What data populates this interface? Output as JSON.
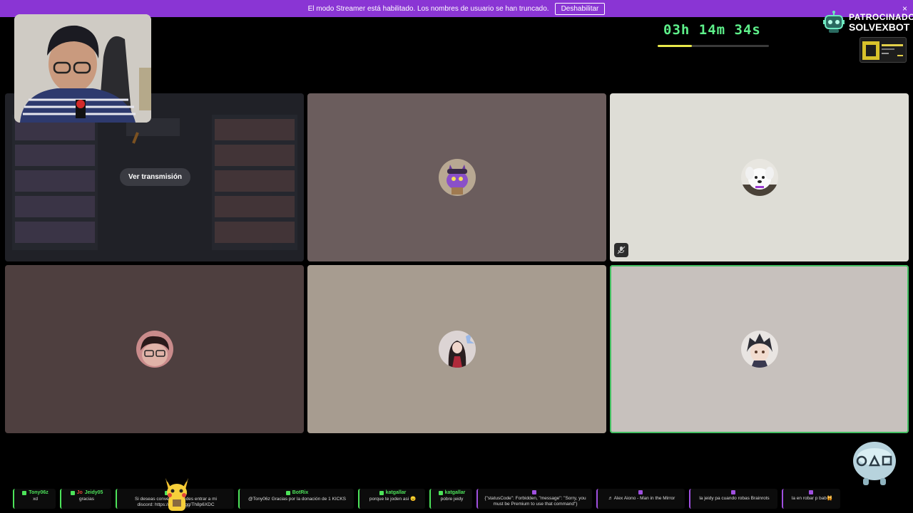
{
  "banner": {
    "message": "El modo Streamer está habilitado. Los nombres de usuario se han truncado.",
    "disable_label": "Deshabilitar",
    "close_glyph": "×"
  },
  "timer": {
    "value": "03h 14m 34s",
    "progress_fraction": 0.31
  },
  "sponsor": {
    "line1": "PATROCINADOR",
    "line2": "SOLVEXBOT",
    "icon": "robot-icon"
  },
  "stage": {
    "watch_label": "Ver transmisión",
    "tiles": [
      {
        "name": "screen-share-tile",
        "bg": "#25262c"
      },
      {
        "name": "participant-tile-2",
        "bg": "#6b5d5d",
        "avatar_bg": "#8a5cc0"
      },
      {
        "name": "participant-tile-3",
        "bg": "#deddd6",
        "avatar_bg": "#e4e4e4",
        "muted_icon": "mic-off-icon"
      },
      {
        "name": "participant-tile-4",
        "bg": "#4e3f3f",
        "avatar_bg": "#c98b8b"
      },
      {
        "name": "participant-tile-5",
        "bg": "#a79c90",
        "avatar_bg": "#d8d0d0"
      },
      {
        "name": "participant-tile-6",
        "bg": "#c7c1bd",
        "avatar_bg": "#e7e2e0",
        "speaking": true
      }
    ]
  },
  "chat": [
    {
      "user": "Tony06z",
      "text": "xd",
      "color": "#4de35a",
      "style": "green"
    },
    {
      "user": "Jeidy05",
      "text": "gracias",
      "color": "#4de35a",
      "style": "green",
      "prefix": "Jo"
    },
    {
      "user": "BotRix",
      "text": "Si deseas conversar puedes entrar a mi\ndiscord: https://discord.gg/Th8p6XDC",
      "color": "#4de35a",
      "style": "green"
    },
    {
      "user": "BotRix",
      "text": "@Tony06z Gracias por la donación de 1 KICKS",
      "color": "#4de35a",
      "style": "green"
    },
    {
      "user": "katgallar",
      "text": "porque te joden asi 😠",
      "color": "#4de35a",
      "style": "green"
    },
    {
      "user": "katgallar",
      "text": "pobre jeidy",
      "color": "#4de35a",
      "style": "green"
    },
    {
      "user": "",
      "text": "{\"statusCode\": Forbidden, \"message\": \"Sorry, you\nmust be Premium to use that command\"}",
      "color": "#a050e0",
      "style": "purple"
    },
    {
      "user": "",
      "text": "♬ Alex Aiono - Man in the Mirror",
      "color": "#a050e0",
      "style": "purple"
    },
    {
      "user": "",
      "text": "la jeidy pa cuando robas Brainrots",
      "color": "#a050e0",
      "style": "purple"
    },
    {
      "user": "",
      "text": "la en robar p bab🙀",
      "color": "#a050e0",
      "style": "purple"
    }
  ]
}
